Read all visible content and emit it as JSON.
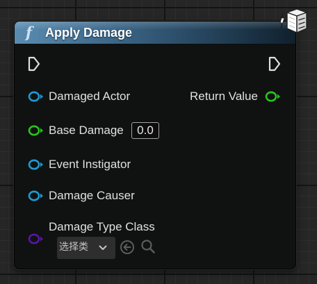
{
  "node": {
    "func_glyph": "f",
    "title": "Apply Damage"
  },
  "pins": {
    "damaged_actor": "Damaged Actor",
    "base_damage": "Base Damage",
    "base_damage_value": "0.0",
    "event_instigator": "Event Instigator",
    "damage_causer": "Damage Causer",
    "damage_type_class": "Damage Type Class",
    "return_value": "Return Value"
  },
  "class_picker": {
    "label": "选择类"
  },
  "colors": {
    "object_pin": "#1e9ad6",
    "float_pin": "#2bc41d",
    "class_pin": "#5a14a8",
    "exec_pin": "#e0e0e0",
    "header_start": "#5b8cb0",
    "header_end": "#10202c"
  },
  "icons": {
    "header": "function-icon",
    "corner": "static-class-cube-icon",
    "exec_in": "exec-in-pin-icon",
    "exec_out": "exec-out-pin-icon",
    "use_selected": "use-selected-arrow-icon",
    "browse": "browse-search-icon"
  }
}
